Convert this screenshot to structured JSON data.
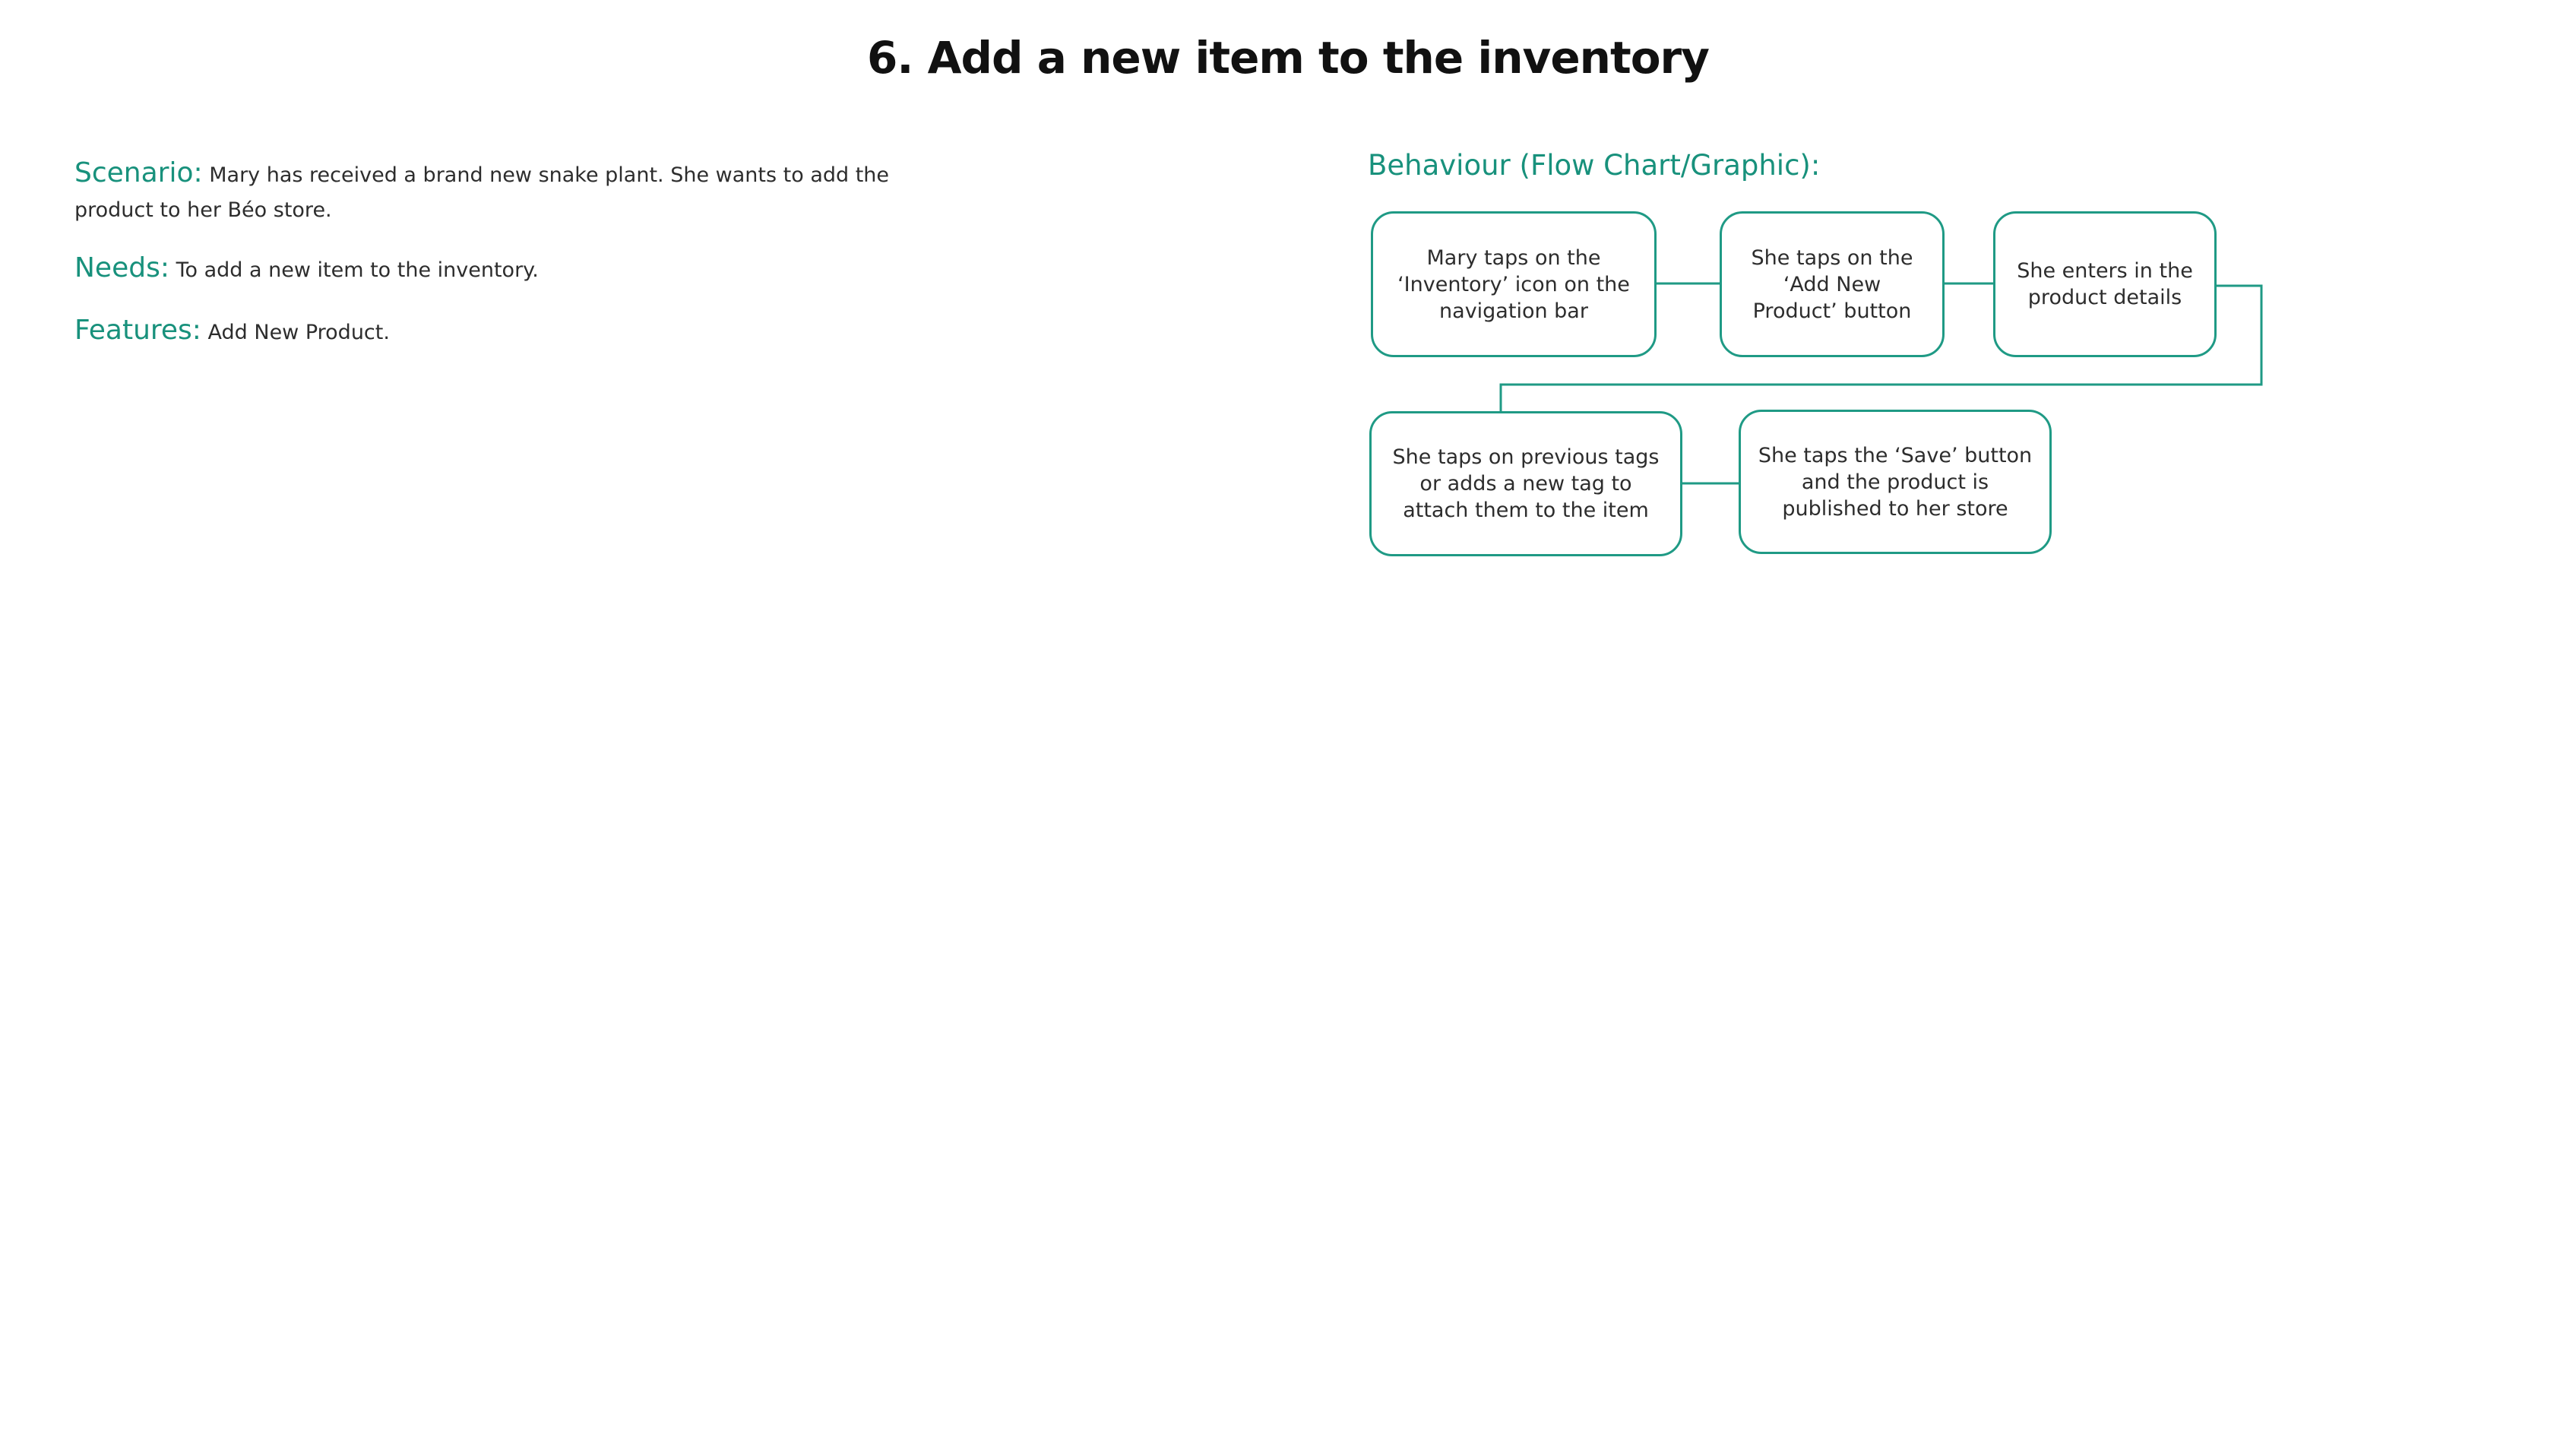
{
  "page": {
    "title": "6. Add a new item to the inventory"
  },
  "scenario": {
    "label": "Scenario:",
    "text": "Mary has received a brand new snake plant. She wants to add the product to her Béo store."
  },
  "needs": {
    "label": "Needs:",
    "text": "To add a new item to the inventory."
  },
  "features": {
    "label": "Features:",
    "text": "Add New Product."
  },
  "behaviour": {
    "title": "Behaviour (Flow Chart/Graphic):",
    "steps": [
      "Mary taps on the ‘Inventory’ icon on the navigation bar",
      "She taps on the ‘Add New Product’ button",
      "She enters in the product details",
      "She taps on previous tags or adds a new tag to attach them to the item",
      "She taps the ‘Save’ button and the product is published to her store"
    ]
  },
  "colors": {
    "accent": "#18917c",
    "border": "#1f9a85",
    "text": "#2d2d2d"
  }
}
